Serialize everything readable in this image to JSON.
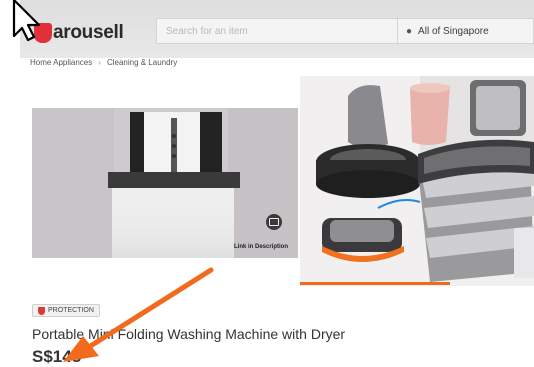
{
  "app": {
    "logo_text": "arousell"
  },
  "search": {
    "placeholder": "Search for an item"
  },
  "location": {
    "label": "All of Singapore"
  },
  "breadcrumb": {
    "items": [
      "Home Appliances",
      "Cleaning & Laundry"
    ]
  },
  "media": {
    "left_caption": "Link in Description"
  },
  "listing": {
    "badge": "PROTECTION",
    "title": "Portable Mini Folding Washing Machine with Dryer",
    "price": "S$148"
  },
  "colors": {
    "brand": "#e0303a",
    "annotation_arrow": "#f26a1c"
  },
  "icons": [
    "cursor-arrow-icon",
    "location-pin-icon",
    "shield-icon",
    "media-icon",
    "annotation-arrow-icon"
  ]
}
